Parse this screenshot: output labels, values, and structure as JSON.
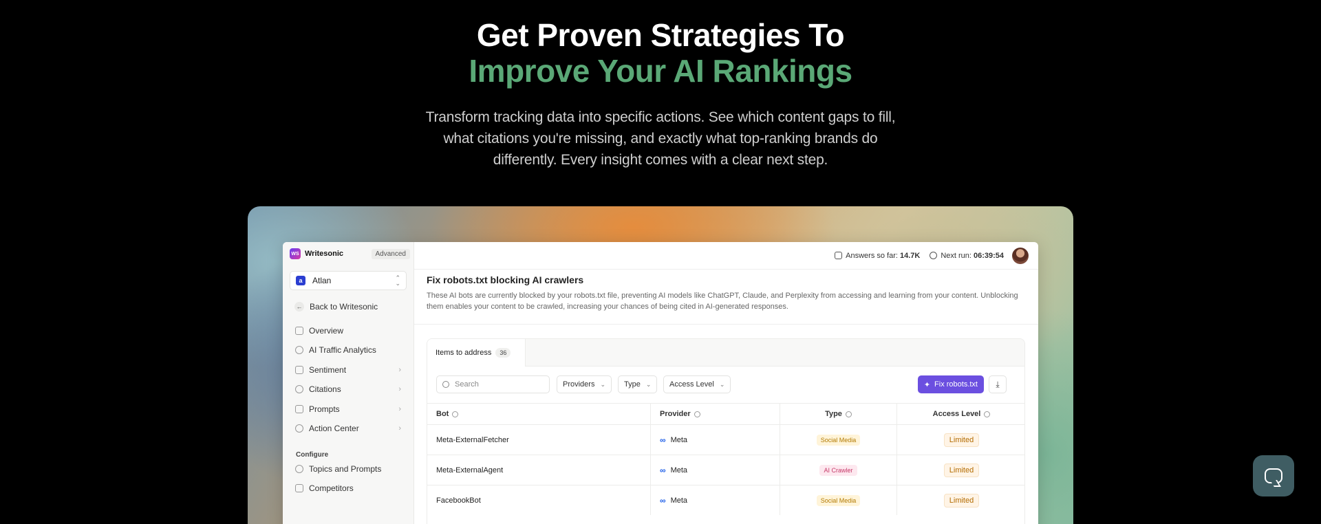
{
  "hero": {
    "title_line1": "Get Proven Strategies To",
    "title_line2": "Improve Your AI Rankings",
    "description": "Transform tracking data into specific actions. See which content gaps to fill, what citations you're missing, and exactly what top-ranking brands do differently. Every insight comes with a clear next step.",
    "accent_color": "#5aa876"
  },
  "app": {
    "brand": {
      "name": "Writesonic",
      "plan": "Advanced",
      "logo_text": "WS"
    },
    "workspace": {
      "name": "Atlan",
      "icon_text": "a"
    },
    "back_label": "Back to Writesonic",
    "nav": [
      {
        "label": "Overview",
        "icon": "overview-icon"
      },
      {
        "label": "AI Traffic Analytics",
        "icon": "globe-icon"
      },
      {
        "label": "Sentiment",
        "icon": "scale-icon"
      },
      {
        "label": "Citations",
        "icon": "link-icon"
      },
      {
        "label": "Prompts",
        "icon": "message-icon"
      },
      {
        "label": "Action Center",
        "icon": "lightbulb-icon"
      }
    ],
    "configure_label": "Configure",
    "configure_items": [
      {
        "label": "Topics and Prompts",
        "icon": "chat-icon"
      },
      {
        "label": "Competitors",
        "icon": "trophy-icon"
      }
    ],
    "topbar": {
      "answers_label": "Answers so far:",
      "answers_value": "14.7K",
      "next_run_label": "Next run:",
      "next_run_value": "06:39:54"
    },
    "page": {
      "title": "Fix robots.txt blocking AI crawlers",
      "description": "These AI bots are currently blocked by your robots.txt file, preventing AI models like ChatGPT, Claude, and Perplexity from accessing and learning from your content. Unblocking them enables your content to be crawled, increasing your chances of being cited in AI-generated responses."
    },
    "tab": {
      "label": "Items to address",
      "count": "36"
    },
    "toolbar": {
      "search_placeholder": "Search",
      "filters": [
        "Providers",
        "Type",
        "Access Level"
      ],
      "fix_button": "Fix robots.txt",
      "fix_color": "#6b4fe0"
    },
    "table": {
      "headers": [
        "Bot",
        "Provider",
        "Type",
        "Access Level"
      ],
      "rows": [
        {
          "bot": "Meta-ExternalFetcher",
          "provider": "Meta",
          "type": "Social Media",
          "access": "Limited"
        },
        {
          "bot": "Meta-ExternalAgent",
          "provider": "Meta",
          "type": "AI Crawler",
          "access": "Limited"
        },
        {
          "bot": "FacebookBot",
          "provider": "Meta",
          "type": "Social Media",
          "access": "Limited"
        }
      ]
    }
  }
}
